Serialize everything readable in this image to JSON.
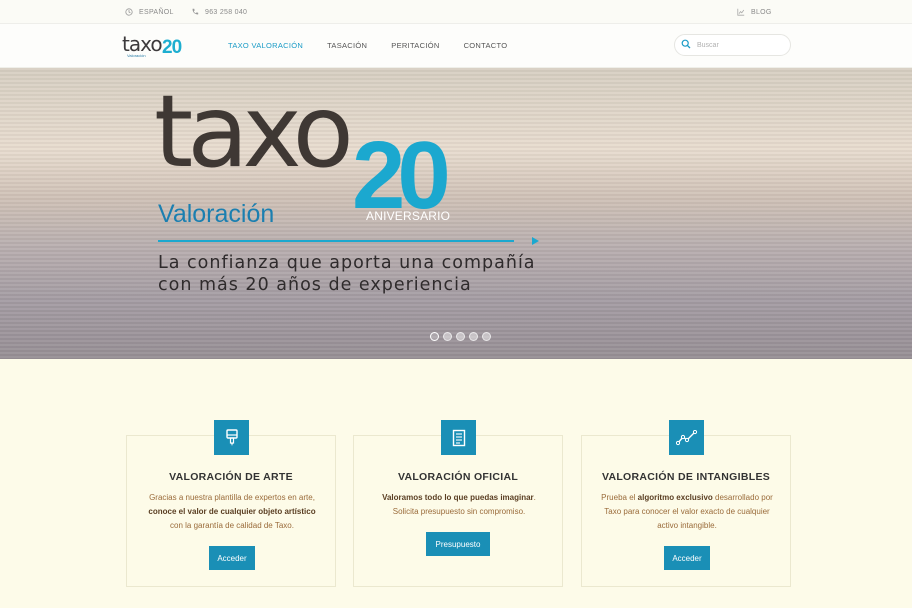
{
  "topbar": {
    "language": "ESPAÑOL",
    "language_icon": "globe-icon",
    "phone": "963 258 040",
    "phone_icon": "phone-icon",
    "blog": "BLOG",
    "blog_icon": "chart-icon"
  },
  "nav": {
    "logo_word": "taxo",
    "logo_sub": "Valoración",
    "logo_number": "20",
    "items": [
      {
        "label": "TAXO VALORACIÓN",
        "active": true
      },
      {
        "label": "TASACIÓN",
        "active": false
      },
      {
        "label": "PERITACIÓN",
        "active": false
      },
      {
        "label": "CONTACTO",
        "active": false
      }
    ],
    "search_placeholder": "Buscar",
    "search_icon": "search-icon"
  },
  "hero": {
    "brand": "taxo",
    "brand_sub": "Valoración",
    "number": "20",
    "badge": "ANIVERSARIO",
    "tagline_line1": "La confianza que aporta una compañía",
    "tagline_line2": "con más 20 años de experiencia",
    "slides_total": 5,
    "slide_active": 1
  },
  "cards": [
    {
      "icon": "paintbrush-icon",
      "title": "VALORACIÓN DE ARTE",
      "desc_1": "Gracias a nuestra plantilla de expertos en arte,",
      "desc_2_bold": "conoce el valor de cualquier objeto artístico",
      "desc_3": "con la garantía de calidad de Taxo.",
      "button": "Acceder"
    },
    {
      "icon": "document-icon",
      "title": "VALORACIÓN OFICIAL",
      "desc_1_bold": "Valoramos todo lo que puedas imaginar",
      "desc_1_end": ".",
      "desc_2": "Solicita presupuesto sin compromiso.",
      "button": "Presupuesto"
    },
    {
      "icon": "line-chart-icon",
      "title": "VALORACIÓN DE INTANGIBLES",
      "desc_1a": "Prueba el ",
      "desc_1_bold": "algoritmo exclusivo",
      "desc_1b": " desarrollado por",
      "desc_2": "Taxo para conocer el valor exacto de cualquier",
      "desc_3": "activo intangible.",
      "button": "Acceder"
    }
  ],
  "colors": {
    "accent": "#1a8fb6",
    "nav_active": "#1a9bc6",
    "brand_dark": "#3f3834",
    "brand_blue": "#1ba8cf",
    "page_bg": "#fdfbe9"
  }
}
